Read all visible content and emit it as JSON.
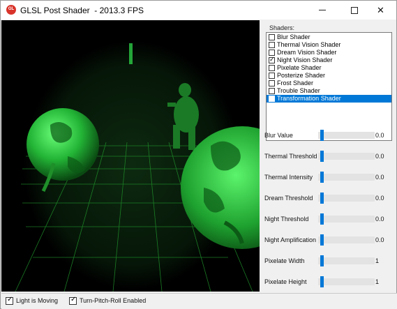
{
  "window": {
    "title": "GLSL Post Shader  - 2013.3 FPS",
    "icon": "app-logo-icon",
    "icon_text": "GL",
    "controls": [
      "minimize-icon",
      "maximize-icon",
      "close-icon"
    ]
  },
  "shaders": {
    "label": "Shaders:",
    "items": [
      {
        "label": "Blur Shader",
        "checked": false,
        "selected": false
      },
      {
        "label": "Thermal Vision Shader",
        "checked": false,
        "selected": false
      },
      {
        "label": "Dream Vision Shader",
        "checked": false,
        "selected": false
      },
      {
        "label": "Night Vision Shader",
        "checked": true,
        "selected": false
      },
      {
        "label": "Pixelate Shader",
        "checked": false,
        "selected": false
      },
      {
        "label": "Posterize Shader",
        "checked": false,
        "selected": false
      },
      {
        "label": "Frost Shader",
        "checked": false,
        "selected": false
      },
      {
        "label": "Trouble Shader",
        "checked": false,
        "selected": false
      },
      {
        "label": "Transformation Shader",
        "checked": false,
        "selected": true
      }
    ]
  },
  "sliders": [
    {
      "label": "Blur Value",
      "value": "0.0",
      "level": 0.0
    },
    {
      "label": "Thermal Threshold",
      "value": "0.0",
      "level": 0.0
    },
    {
      "label": "Thermal Intensity",
      "value": "0.0",
      "level": 0.0
    },
    {
      "label": "Dream Threshold",
      "value": "0.0",
      "level": 0.0
    },
    {
      "label": "Night Threshold",
      "value": "0.0",
      "level": 0.0
    },
    {
      "label": "Night Amplification",
      "value": "0.0",
      "level": 0.0
    },
    {
      "label": "Pixelate Width",
      "value": "1",
      "level": 0.0
    },
    {
      "label": "Pixelate Height",
      "value": "1",
      "level": 0.0
    }
  ],
  "bottom": {
    "light_moving": {
      "label": "Light is Moving",
      "checked": true
    },
    "turn_pitch_roll": {
      "label": "Turn-Pitch-Roll Enabled",
      "checked": true
    }
  },
  "colors": {
    "accent": "#0078d7",
    "night_vision_green": "#2fd84a",
    "grid_green": "#1f8f2a"
  }
}
